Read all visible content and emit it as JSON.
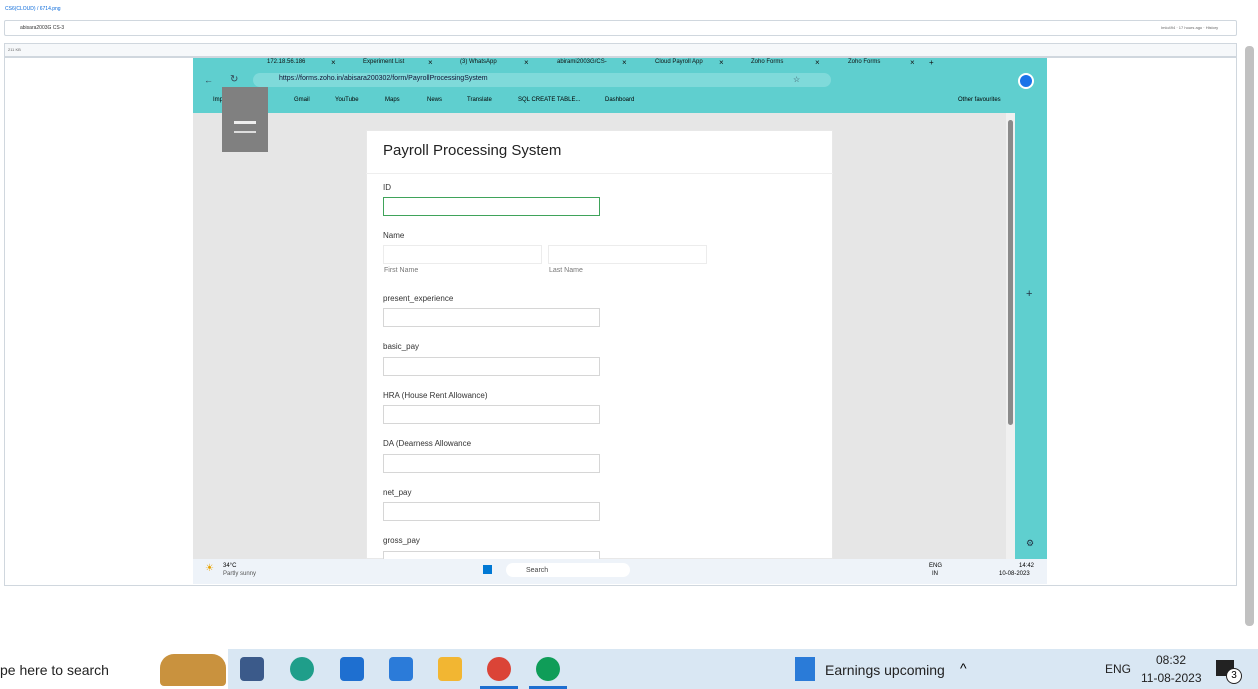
{
  "github": {
    "path": "CS6(CLOUD) / 6714.png",
    "commit": "abisara2003G  CS-3",
    "history_label": "History",
    "size_label": "211 KB",
    "updated": "Imlo494 · 17 hours ago"
  },
  "browser": {
    "tabs": [
      {
        "label": "172.18.56.186"
      },
      {
        "label": "Experiment List"
      },
      {
        "label": "(3) WhatsApp"
      },
      {
        "label": "abirami2003G/CS-"
      },
      {
        "label": "Cloud Payroll App"
      },
      {
        "label": "Zoho Forms"
      },
      {
        "label": "Zoho Forms"
      }
    ],
    "url": "https://forms.zoho.in/abisara200302/form/PayrollProcessingSystem",
    "favourites": [
      "Import favourites",
      "Gmail",
      "YouTube",
      "Maps",
      "News",
      "Translate",
      "SQL CREATE TABLE...",
      "Dashboard"
    ],
    "other_favourites": "Other favourites"
  },
  "form": {
    "title": "Payroll Processing System",
    "fields": {
      "id": "ID",
      "name": "Name",
      "first_name": "First Name",
      "last_name": "Last Name",
      "present_experience": "present_experience",
      "basic_pay": "basic_pay",
      "hra": "HRA (House Rent Allowance)",
      "da": "DA (Dearness Allowance",
      "net_pay": "net_pay",
      "gross_pay": "gross_pay"
    }
  },
  "inner_taskbar": {
    "temp": "34°C",
    "weather": "Partly sunny",
    "search": "Search",
    "lang1": "ENG",
    "lang2": "IN",
    "time": "14:42",
    "date": "10-08-2023"
  },
  "taskbar": {
    "search_text": "pe here to search",
    "earnings": "Earnings upcoming",
    "lang": "ENG",
    "time": "08:32",
    "date": "11-08-2023",
    "notif_count": "3"
  },
  "colors": {
    "accent": "#5fcfcf",
    "focus": "#3fa35a"
  }
}
